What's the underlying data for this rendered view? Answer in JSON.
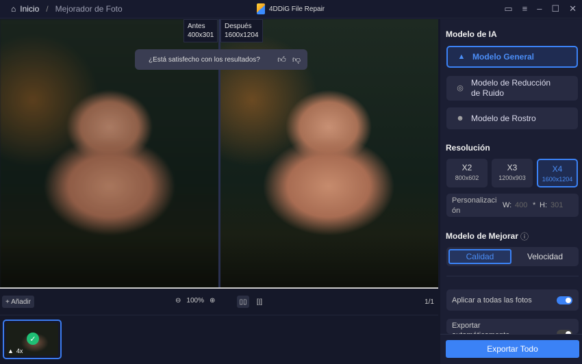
{
  "header": {
    "home": "Inicio",
    "current": "Mejorador de Foto",
    "app_title": "4DDiG File Repair"
  },
  "viewer": {
    "before_label": "Antes",
    "before_size": "400x301",
    "after_label": "Después",
    "after_size": "1600x1204",
    "feedback_question": "¿Está satisfecho con los resultados?"
  },
  "toolbar": {
    "add": "+ Añadir",
    "zoom": "100%",
    "page": "1/1"
  },
  "thumbnail": {
    "scale": "4x"
  },
  "panel": {
    "ai_model_title": "Modelo de IA",
    "models": [
      {
        "label": "Modelo General",
        "selected": true
      },
      {
        "label": "Modelo de Reducción de Ruido"
      },
      {
        "label": "Modelo de Rostro"
      }
    ],
    "resolution_title": "Resolución",
    "resolutions": [
      {
        "scale": "X2",
        "size": "800x602"
      },
      {
        "scale": "X3",
        "size": "1200x903"
      },
      {
        "scale": "X4",
        "size": "1600x1204",
        "selected": true
      }
    ],
    "custom": {
      "label": "Personalizaci ón",
      "w_label": "W:",
      "w_value": "400",
      "sep": "*",
      "h_label": "H:",
      "h_value": "301"
    },
    "enhance_title": "Modelo de Mejorar",
    "enhance_options": [
      "Calidad",
      "Velocidad"
    ],
    "apply_all": "Aplicar a todas las fotos",
    "apply_all_on": true,
    "auto_export": "Exportar automáticamente",
    "export_all": "Exportar Todo"
  },
  "colors": {
    "accent": "#3b82f6",
    "success": "#1fbf75"
  }
}
